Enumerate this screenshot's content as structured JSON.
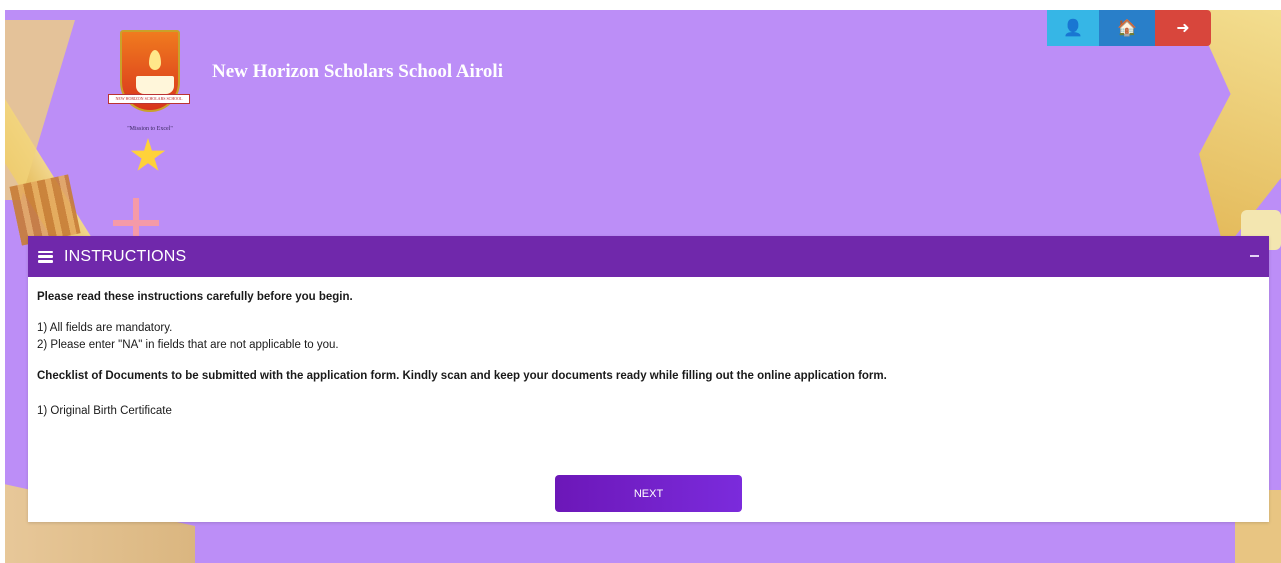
{
  "header": {
    "school_name": "New Horizon Scholars School Airoli",
    "logo_band_text": "NEW HORIZON SCHOLARS SCHOOL",
    "logo_motto": "\"Mission to Excel\""
  },
  "top_buttons": [
    {
      "icon": "user-icon",
      "glyph": "👤",
      "color": "#36b6e6"
    },
    {
      "icon": "home-icon",
      "glyph": "🏠",
      "color": "#297fc9"
    },
    {
      "icon": "logout-icon",
      "glyph": "➜",
      "color": "#d8463c"
    }
  ],
  "panel": {
    "title": "INSTRUCTIONS",
    "lead": "Please read these instructions carefully before you begin.",
    "rules": [
      "1) All fields are mandatory.",
      "2) Please enter \"NA\" in fields that are not applicable to you."
    ],
    "checklist_heading": "Checklist of Documents to be submitted with the application form. Kindly scan and keep your documents ready while filling out the online application form.",
    "documents": [
      "1) Original Birth Certificate"
    ],
    "next_label": "NEXT"
  },
  "colors": {
    "background": "#bc8ef7",
    "panel_header": "#7028ab",
    "next_button": "#7b2bdc"
  }
}
